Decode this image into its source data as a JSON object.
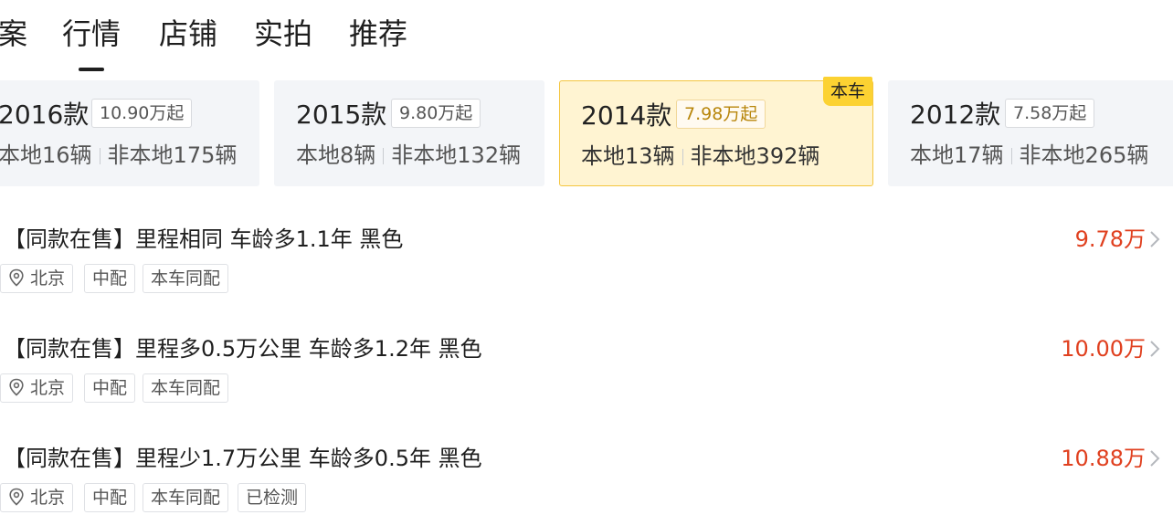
{
  "tabs": [
    {
      "label": "案"
    },
    {
      "label": "行情",
      "active": true
    },
    {
      "label": "店铺"
    },
    {
      "label": "实拍"
    },
    {
      "label": "推荐"
    }
  ],
  "years": [
    {
      "year": "2016款",
      "price": "10.90万起",
      "local": "本地16辆",
      "nonlocal": "非本地175辆"
    },
    {
      "year": "2015款",
      "price": "9.80万起",
      "local": "本地8辆",
      "nonlocal": "非本地132辆"
    },
    {
      "year": "2014款",
      "price": "7.98万起",
      "local": "本地13辆",
      "nonlocal": "非本地392辆",
      "badge": "本车"
    },
    {
      "year": "2012款",
      "price": "7.58万起",
      "local": "本地17辆",
      "nonlocal": "非本地265辆"
    }
  ],
  "listings": [
    {
      "title": "【同款在售】里程相同 车龄多1.1年 黑色",
      "price": "9.78万",
      "tags": [
        "北京",
        "中配",
        "本车同配"
      ]
    },
    {
      "title": "【同款在售】里程多0.5万公里 车龄多1.2年 黑色",
      "price": "10.00万",
      "tags": [
        "北京",
        "中配",
        "本车同配"
      ]
    },
    {
      "title": "【同款在售】里程少1.7万公里 车龄多0.5年 黑色",
      "price": "10.88万",
      "tags": [
        "北京",
        "中配",
        "本车同配",
        "已检测"
      ]
    }
  ],
  "colors": {
    "price": "#e0401f",
    "highlight_bg": "#fff4d2",
    "badge": "#fcd232"
  },
  "icons": {
    "location": "location-pin-icon",
    "chevron": "chevron-right-icon"
  }
}
